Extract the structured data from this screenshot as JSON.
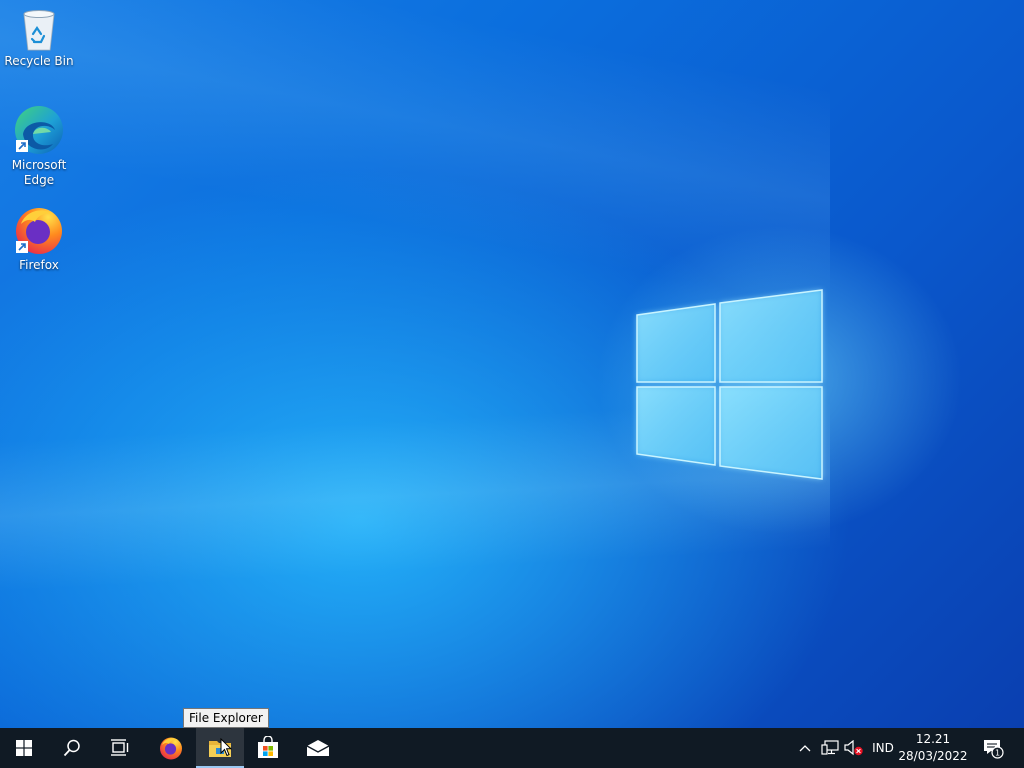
{
  "desktop": {
    "icons": [
      {
        "label": "Recycle Bin",
        "icon": "recycle-bin-icon"
      },
      {
        "label": "Microsoft Edge",
        "icon": "edge-icon"
      },
      {
        "label": "Firefox",
        "icon": "firefox-icon"
      }
    ]
  },
  "taskbar": {
    "start": "windows-start-icon",
    "search": "search-icon",
    "task_view": "task-view-icon",
    "pinned": [
      {
        "name": "Firefox",
        "icon": "firefox-icon"
      },
      {
        "name": "File Explorer",
        "icon": "folder-icon",
        "active": true
      },
      {
        "name": "Microsoft Store",
        "icon": "store-icon"
      },
      {
        "name": "Mail",
        "icon": "mail-icon"
      }
    ],
    "tooltip": "File Explorer",
    "tray": {
      "language": "IND",
      "time": "12.21",
      "date": "28/03/2022",
      "notification_count": "1"
    }
  },
  "colors": {
    "taskbar_bg": "#101a24",
    "desktop_accent": "#0a64d8"
  }
}
